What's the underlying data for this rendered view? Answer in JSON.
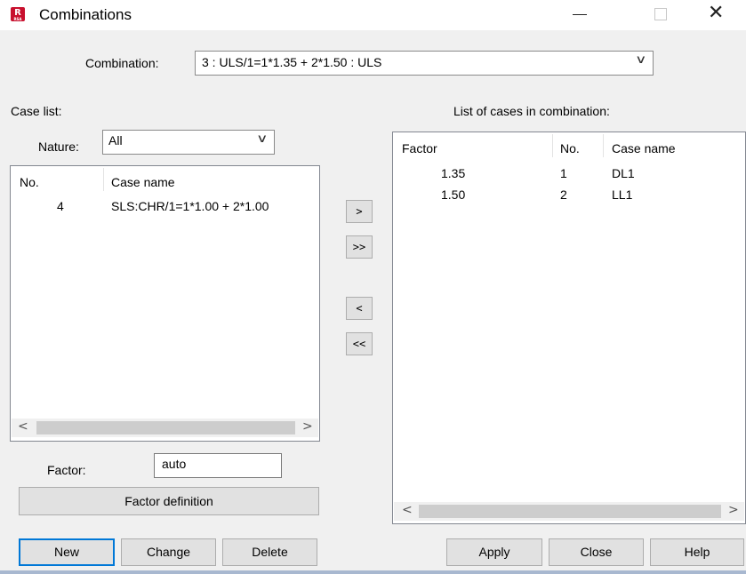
{
  "window": {
    "title": "Combinations",
    "app_icon_letter": "R",
    "app_icon_caption": "RSA",
    "minimize_glyph": "—",
    "close_glyph": "✕"
  },
  "combination": {
    "label": "Combination:",
    "selected": "3 : ULS/1=1*1.35 + 2*1.50 : ULS",
    "chevron": "∨"
  },
  "case_list": {
    "title": "Case list:",
    "nature_label": "Nature:",
    "nature_selected": "All",
    "chevron": "∨",
    "columns": [
      "No.",
      "Case name"
    ],
    "rows": [
      {
        "no": "4",
        "name": "SLS:CHR/1=1*1.00 + 2*1.00"
      }
    ],
    "scroll_left": "<",
    "scroll_right": ">"
  },
  "factor": {
    "label": "Factor:",
    "value": "auto",
    "definition_button": "Factor definition"
  },
  "transfer_buttons": {
    "add": ">",
    "add_all": ">>",
    "remove": "<",
    "remove_all": "<<"
  },
  "combination_cases": {
    "title": "List of cases in combination:",
    "columns": [
      "Factor",
      "No.",
      "Case name"
    ],
    "rows": [
      {
        "factor": "1.35",
        "no": "1",
        "name": "DL1"
      },
      {
        "factor": "1.50",
        "no": "2",
        "name": "LL1"
      }
    ],
    "scroll_left": "<",
    "scroll_right": ">"
  },
  "actions": {
    "new": "New",
    "change": "Change",
    "delete": "Delete",
    "apply": "Apply",
    "close": "Close",
    "help": "Help"
  },
  "colors": {
    "accent_focus": "#0078d7",
    "app_icon": "#c8102e"
  }
}
